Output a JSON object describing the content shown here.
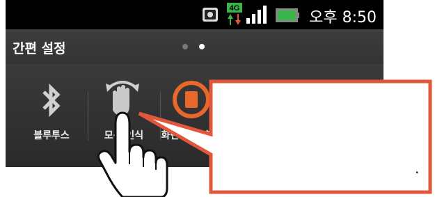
{
  "status_bar": {
    "network": "4G",
    "time_prefix": "오후",
    "time": "8:50",
    "icons": [
      "screenshot-icon",
      "4g-data-icon",
      "signal-bars-icon",
      "battery-icon"
    ]
  },
  "header": {
    "title": "간편 설정",
    "page_count": 2,
    "active_page": 2
  },
  "quick_settings": [
    {
      "id": "bluetooth",
      "icon": "bluetooth-icon",
      "label": "블루투스"
    },
    {
      "id": "motion",
      "icon": "motion-gesture-icon",
      "label": "모션 인식"
    },
    {
      "id": "screen-rotation",
      "icon": "screen-rotation-icon",
      "label": "화면 자동 회전"
    }
  ],
  "callout": {
    "text": "",
    "trailing": "."
  },
  "colors": {
    "accent_orange": "#e8672b",
    "callout_border": "#e2563c",
    "status_bar_bg": "#000000",
    "panel_bg": "#2b2b2b"
  }
}
